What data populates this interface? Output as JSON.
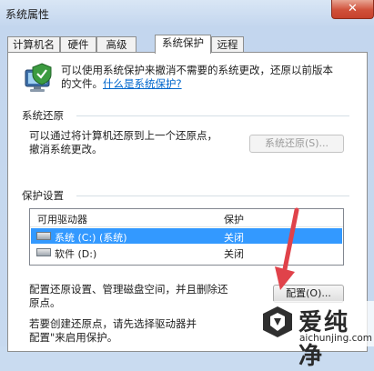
{
  "window": {
    "title": "系统属性",
    "close_glyph": "✕"
  },
  "tabs": [
    {
      "label": "计算机名"
    },
    {
      "label": "硬件"
    },
    {
      "label": "高级"
    },
    {
      "label": "系统保护",
      "active": true
    },
    {
      "label": "远程"
    }
  ],
  "intro": {
    "text_line1": "可以使用系统保护来撤消不需要的系统更改，还原以前版本",
    "text_line2": "的文件。",
    "link": "什么是系统保护?"
  },
  "restore": {
    "group_label": "系统还原",
    "text_line1": "可以通过将计算机还原到上一个还原点，",
    "text_line2": "撤消系统更改。",
    "button": "系统还原(S)..."
  },
  "protection": {
    "group_label": "保护设置",
    "columns": [
      "可用驱动器",
      "保护"
    ],
    "drives": [
      {
        "name": "系统 (C:) (系统)",
        "status": "关闭",
        "selected": true,
        "icon": "system-drive-icon"
      },
      {
        "name": "软件 (D:)",
        "status": "关闭",
        "selected": false,
        "icon": "drive-icon"
      }
    ]
  },
  "configure": {
    "text_line1": "配置还原设置、管理磁盘空间，并且删除还",
    "text_line2": "原点。",
    "button": "配置(O)..."
  },
  "create": {
    "text_line1": "若要创建还原点，请先选择驱动器并",
    "text_line2": "配置\"来启用保护。"
  },
  "watermark": {
    "brand": "爱纯净",
    "url": "aichunjing.com"
  },
  "colors": {
    "selection": "#3399ff",
    "link": "#0066cc",
    "arrow": "#e0424a",
    "close": "#c6412c"
  }
}
